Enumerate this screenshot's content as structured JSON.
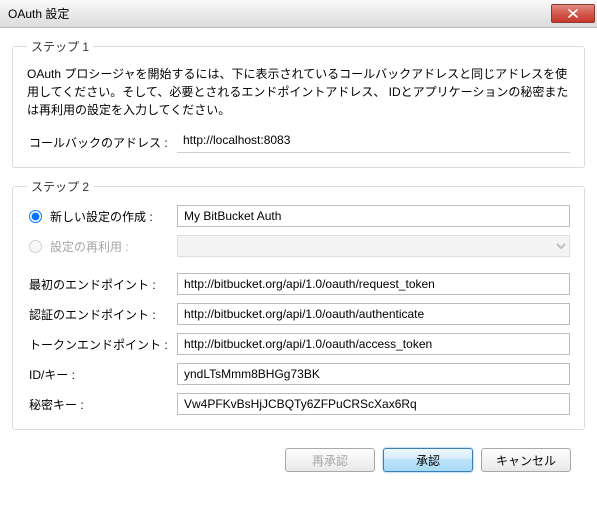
{
  "titlebar": {
    "title": "OAuth 設定"
  },
  "step1": {
    "legend": "ステップ 1",
    "instructions": "OAuth プロシージャを開始するには、下に表示されているコールバックアドレスと同じアドレスを使用してください。そして、必要とされるエンドポイントアドレス、 IDとアプリケーションの秘密または再利用の設定を入力してください。",
    "callback_label": "コールバックのアドレス :",
    "callback_value": "http://localhost:8083"
  },
  "step2": {
    "legend": "ステップ 2",
    "create_label": "新しい設定の作成 :",
    "create_value": "My BitBucket Auth",
    "reuse_label": "設定の再利用 :",
    "first_endpoint_label": "最初のエンドポイント :",
    "first_endpoint_value": "http://bitbucket.org/api/1.0/oauth/request_token",
    "auth_endpoint_label": "認証のエンドポイント :",
    "auth_endpoint_value": "http://bitbucket.org/api/1.0/oauth/authenticate",
    "token_endpoint_label": "トークンエンドポイント :",
    "token_endpoint_value": "http://bitbucket.org/api/1.0/oauth/access_token",
    "id_key_label": "ID/キー :",
    "id_key_value": "yndLTsMmm8BHGg73BK",
    "secret_key_label": "秘密キー :",
    "secret_key_value": "Vw4PFKvBsHjJCBQTy6ZFPuCRScXax6Rq"
  },
  "buttons": {
    "reauth": "再承認",
    "approve": "承認",
    "cancel": "キャンセル"
  }
}
